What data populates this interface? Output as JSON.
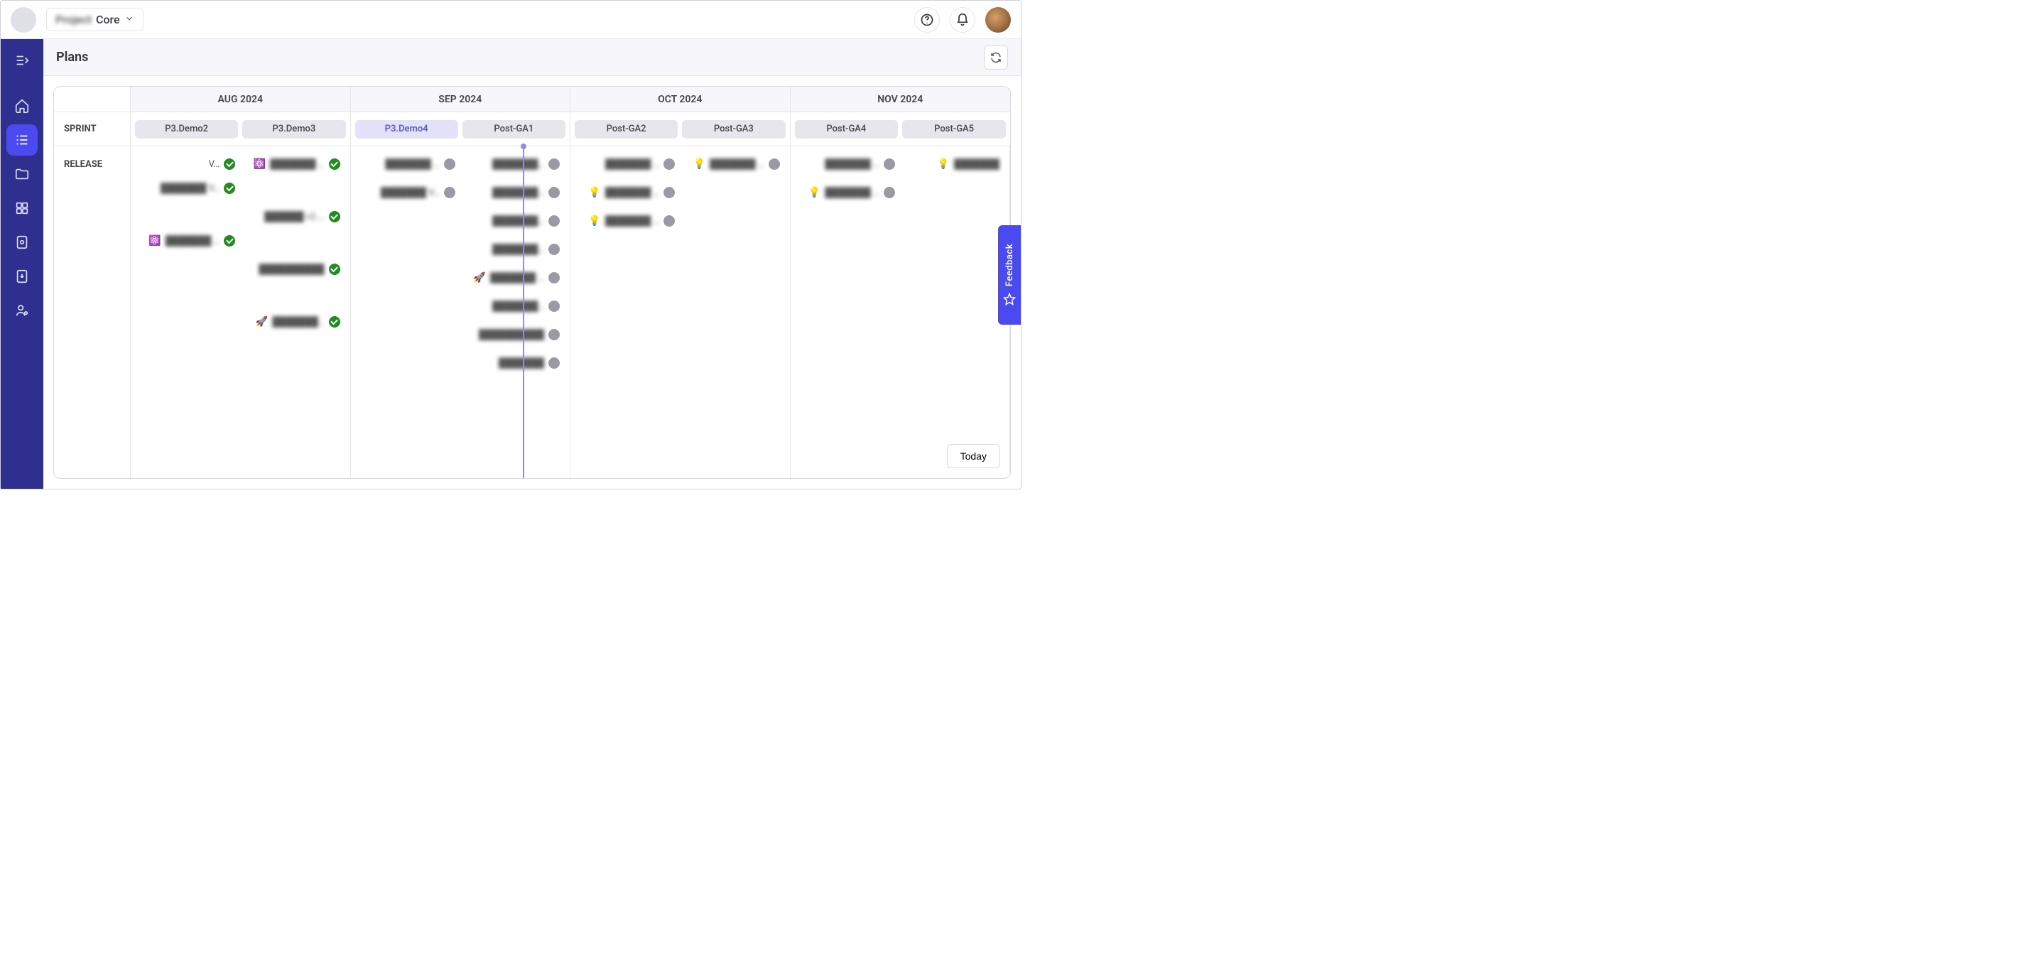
{
  "project": {
    "name_blurred": "Project",
    "name_suffix": "Core"
  },
  "page_title": "Plans",
  "months": [
    "AUG 2024",
    "SEP 2024",
    "OCT 2024",
    "NOV 2024"
  ],
  "sprint_label": "SPRINT",
  "release_label": "RELEASE",
  "sprints": [
    {
      "label": "P3.Demo2",
      "active": false
    },
    {
      "label": "P3.Demo3",
      "active": false
    },
    {
      "label": "P3.Demo4",
      "active": true
    },
    {
      "label": "Post-GA1",
      "active": false
    },
    {
      "label": "Post-GA2",
      "active": false
    },
    {
      "label": "Post-GA3",
      "active": false
    },
    {
      "label": "Post-GA4",
      "active": false
    },
    {
      "label": "Post-GA5",
      "active": false
    }
  ],
  "release_rows": [
    [
      {
        "emoji": "",
        "text": "V…",
        "blur": false,
        "status": "done"
      },
      {
        "emoji": "",
        "text": "███████ V…",
        "blur": true,
        "status": "done"
      },
      {
        "emoji": "⚛️",
        "text": "███████ …",
        "blur": true,
        "status": "done"
      },
      {
        "emoji": "",
        "text": "███████ …",
        "blur": true,
        "status": "todo"
      },
      {
        "emoji": "",
        "text": "███████…",
        "blur": true,
        "status": "todo"
      },
      {
        "emoji": "",
        "text": "███████ …",
        "blur": true,
        "status": "todo"
      },
      {
        "emoji": "💡",
        "text": "███████ …",
        "blur": true,
        "status": "todo"
      },
      {
        "emoji": "",
        "text": "███████ …",
        "blur": true,
        "status": "todo"
      },
      {
        "emoji": "💡",
        "text": "███████",
        "blur": true,
        "status": ""
      }
    ],
    [
      null,
      {
        "emoji": "⚛️",
        "text": "███████ …",
        "blur": true,
        "status": "done"
      },
      {
        "emoji": "",
        "text": "██████ v2.…",
        "blur": true,
        "status": "done"
      },
      {
        "emoji": "",
        "text": "███████ V…",
        "blur": true,
        "status": "todo"
      },
      {
        "emoji": "",
        "text": "███████…",
        "blur": true,
        "status": "todo"
      },
      {
        "emoji": "💡",
        "text": "███████ …",
        "blur": true,
        "status": "todo"
      },
      null,
      {
        "emoji": "💡",
        "text": "███████ …",
        "blur": true,
        "status": "todo"
      },
      null
    ],
    [
      null,
      null,
      {
        "emoji": "",
        "text": "██████████",
        "blur": true,
        "status": "done"
      },
      null,
      {
        "emoji": "",
        "text": "███████…",
        "blur": true,
        "status": "todo"
      },
      {
        "emoji": "💡",
        "text": "███████ …",
        "blur": true,
        "status": "todo"
      },
      null,
      null,
      null
    ],
    [
      null,
      null,
      {
        "emoji": "🚀",
        "text": "███████…",
        "blur": true,
        "status": "done"
      },
      null,
      {
        "emoji": "",
        "text": "███████…",
        "blur": true,
        "status": "todo"
      },
      null,
      null,
      null,
      null
    ],
    [
      null,
      null,
      null,
      null,
      {
        "emoji": "🚀",
        "text": "███████ …",
        "blur": true,
        "status": "todo"
      },
      null,
      null,
      null,
      null
    ],
    [
      null,
      null,
      null,
      null,
      {
        "emoji": "",
        "text": "███████…",
        "blur": true,
        "status": "todo"
      },
      null,
      null,
      null,
      null
    ],
    [
      null,
      null,
      null,
      null,
      {
        "emoji": "",
        "text": "██████████",
        "blur": true,
        "status": "todo"
      },
      null,
      null,
      null,
      null
    ],
    [
      null,
      null,
      null,
      null,
      {
        "emoji": "",
        "text": "███████",
        "blur": true,
        "status": "todo"
      },
      null,
      null,
      null,
      null
    ]
  ],
  "today_line_pct": 49.0,
  "today_btn": "Today",
  "feedback_label": "Feedback"
}
